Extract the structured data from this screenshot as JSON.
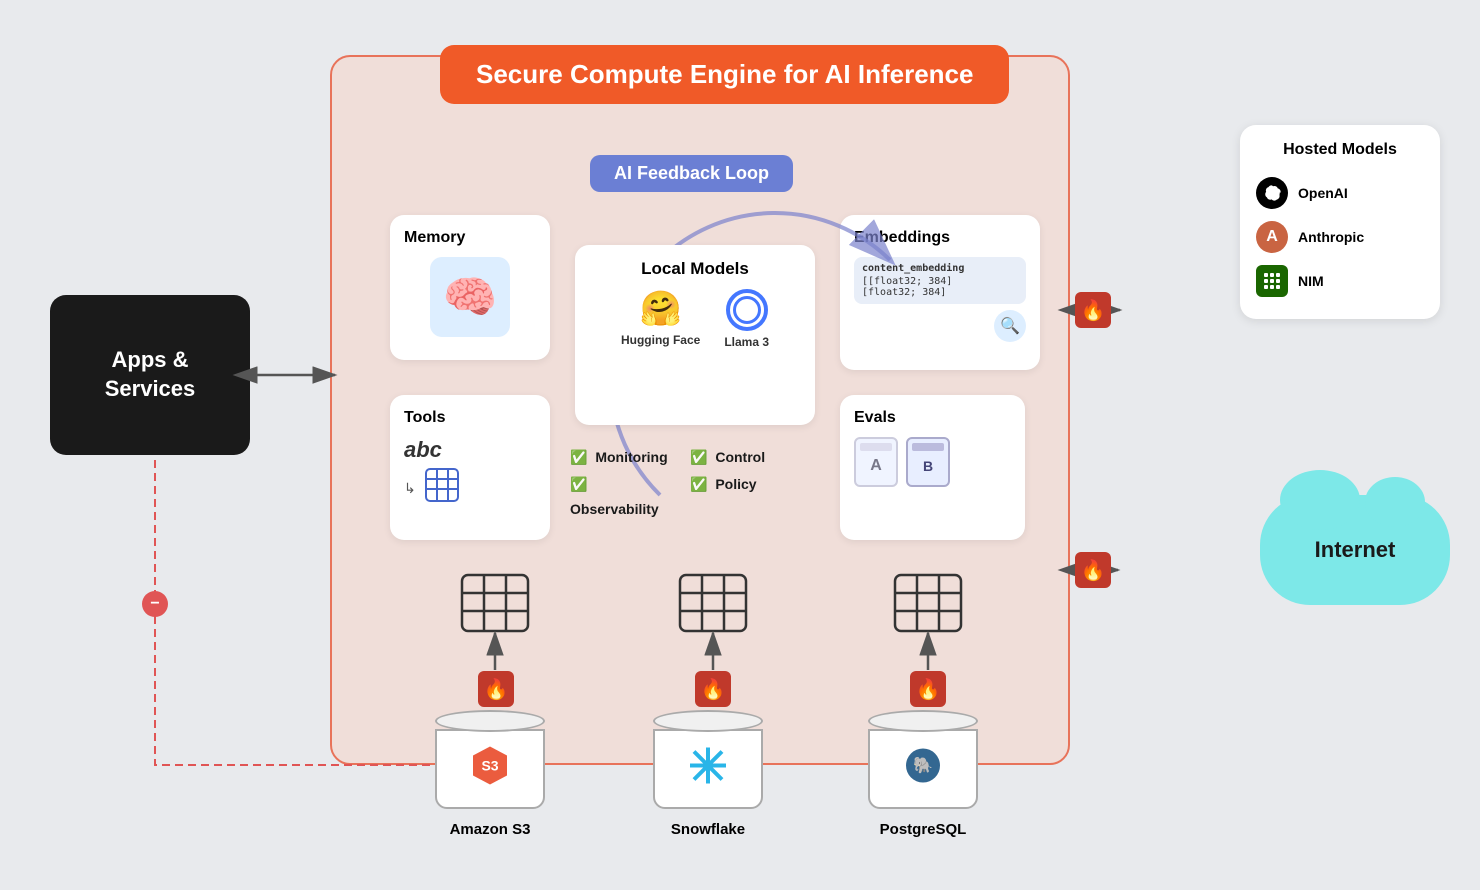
{
  "title": "Secure Compute Engine for AI Inference",
  "feedback_loop_label": "AI Feedback Loop",
  "apps_services": {
    "line1": "Apps &",
    "line2": "Services"
  },
  "hosted_models": {
    "title": "Hosted Models",
    "items": [
      {
        "name": "OpenAI",
        "short": "⊕",
        "type": "openai"
      },
      {
        "name": "Anthropic",
        "short": "A",
        "type": "anthropic"
      },
      {
        "name": "NIM",
        "short": "❖",
        "type": "nim"
      }
    ]
  },
  "internet": {
    "label": "Internet"
  },
  "memory": {
    "title": "Memory",
    "emoji": "🧠"
  },
  "tools": {
    "title": "Tools",
    "abc_label": "abc",
    "arrow_label": "↳"
  },
  "local_models": {
    "title": "Local Models",
    "items": [
      {
        "label": "Hugging Face",
        "type": "emoji",
        "value": "🤗"
      },
      {
        "label": "Llama 3",
        "type": "circle"
      }
    ]
  },
  "features": {
    "items": [
      {
        "label": "Monitoring",
        "check": "✅"
      },
      {
        "label": "Control",
        "check": "✅"
      },
      {
        "label": "Observability",
        "check": "✅"
      },
      {
        "label": "Policy",
        "check": "✅"
      }
    ]
  },
  "embeddings": {
    "title": "Embeddings",
    "code_line1": "content_embedding",
    "code_line2": "[[float32; 384]",
    "code_line3": "[float32; 384]"
  },
  "evals": {
    "title": "Evals",
    "label_a": "A",
    "label_b": "B"
  },
  "databases": [
    {
      "name": "Amazon S3",
      "logo": "🔺"
    },
    {
      "name": "Snowflake",
      "logo": "❄️"
    },
    {
      "name": "PostgreSQL",
      "logo": "🐘"
    }
  ],
  "colors": {
    "orange": "#f05a28",
    "purple": "#6b7fd4",
    "teal": "#7de8e8",
    "dark": "#1a1a1a",
    "fire_red": "#c0392b"
  }
}
